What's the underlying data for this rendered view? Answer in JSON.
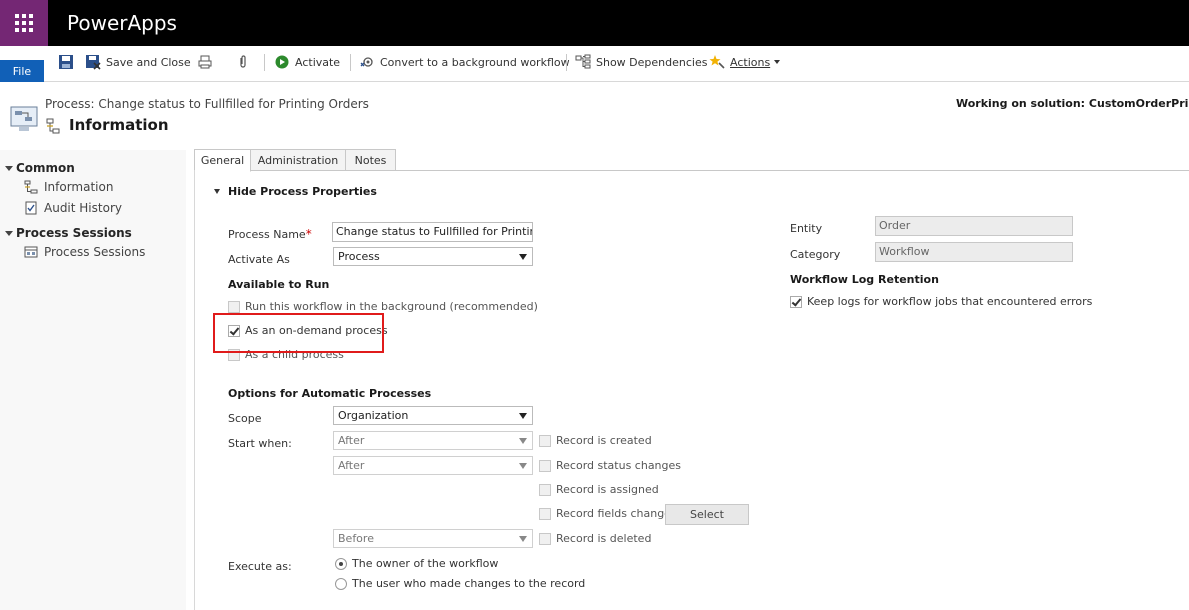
{
  "app": {
    "title": "PowerApps"
  },
  "commands": {
    "file": "File",
    "save_and_close": "Save and Close",
    "activate": "Activate",
    "convert": "Convert to a background workflow",
    "show_dependencies": "Show Dependencies",
    "actions": "Actions"
  },
  "header": {
    "process_subtitle": "Process: Change status to Fullfilled for Printing Orders",
    "title": "Information",
    "working_on": "Working on solution: CustomOrderPrinting_E"
  },
  "nav": {
    "groups": [
      {
        "label": "Common",
        "items": [
          "Information",
          "Audit History"
        ]
      },
      {
        "label": "Process Sessions",
        "items": [
          "Process Sessions"
        ]
      }
    ]
  },
  "tabs": [
    "General",
    "Administration",
    "Notes"
  ],
  "form": {
    "section_title": "Hide Process Properties",
    "process_name_label": "Process Name",
    "required_mark": "*",
    "process_name_value": "Change status to Fullfilled for Printing O",
    "activate_as_label": "Activate As",
    "activate_as_value": "Process",
    "available_to_run": "Available to Run",
    "run_background": "Run this workflow in the background (recommended)",
    "on_demand": "As an on-demand process",
    "child_process": "As a child process",
    "options_auto": "Options for Automatic Processes",
    "scope_label": "Scope",
    "scope_value": "Organization",
    "start_when_label": "Start when:",
    "after_1": "After",
    "after_2": "After",
    "before": "Before",
    "record_created": "Record is created",
    "record_status": "Record status changes",
    "record_assigned": "Record is assigned",
    "record_fields": "Record fields change",
    "select_button": "Select",
    "record_deleted": "Record is deleted",
    "execute_as_label": "Execute as:",
    "owner_option": "The owner of the workflow",
    "user_option": "The user who made changes to the record",
    "entity_label": "Entity",
    "entity_value": "Order",
    "category_label": "Category",
    "category_value": "Workflow",
    "log_retention": "Workflow Log Retention",
    "keep_logs": "Keep logs for workflow jobs that encountered errors"
  },
  "colors": {
    "waffle": "#742774",
    "file": "#1160b7",
    "highlight": "#e01b1b"
  }
}
